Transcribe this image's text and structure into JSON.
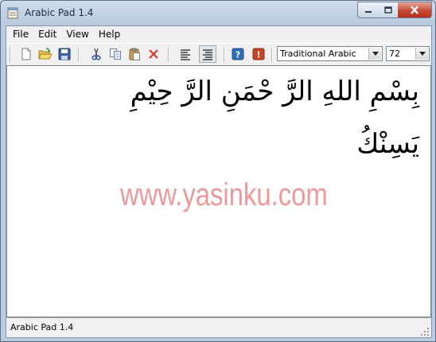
{
  "window": {
    "title": "Arabic Pad 1.4"
  },
  "menu": {
    "items": [
      "File",
      "Edit",
      "View",
      "Help"
    ]
  },
  "toolbar": {
    "font_value": "Traditional Arabic",
    "size_value": "72",
    "icons": [
      "new-file-icon",
      "open-folder-icon",
      "save-disk-icon",
      "cut-scissors-icon",
      "copy-icon",
      "paste-clipboard-icon",
      "delete-x-icon",
      "align-left-icon",
      "align-right-icon",
      "help-icon",
      "about-icon"
    ]
  },
  "editor": {
    "line1": "بِسْمِ اللهِ الرَّ حْمَنِ الرَّ حِيْمِ",
    "line2": "يَسِنْكُ",
    "watermark": "www.yasinku.com"
  },
  "status": {
    "text": "Arabic Pad 1.4"
  },
  "colors": {
    "close_button": "#c44a36",
    "watermark": "#ec8f8f",
    "help_icon": "#2f6db6",
    "about_icon": "#c8452a"
  }
}
